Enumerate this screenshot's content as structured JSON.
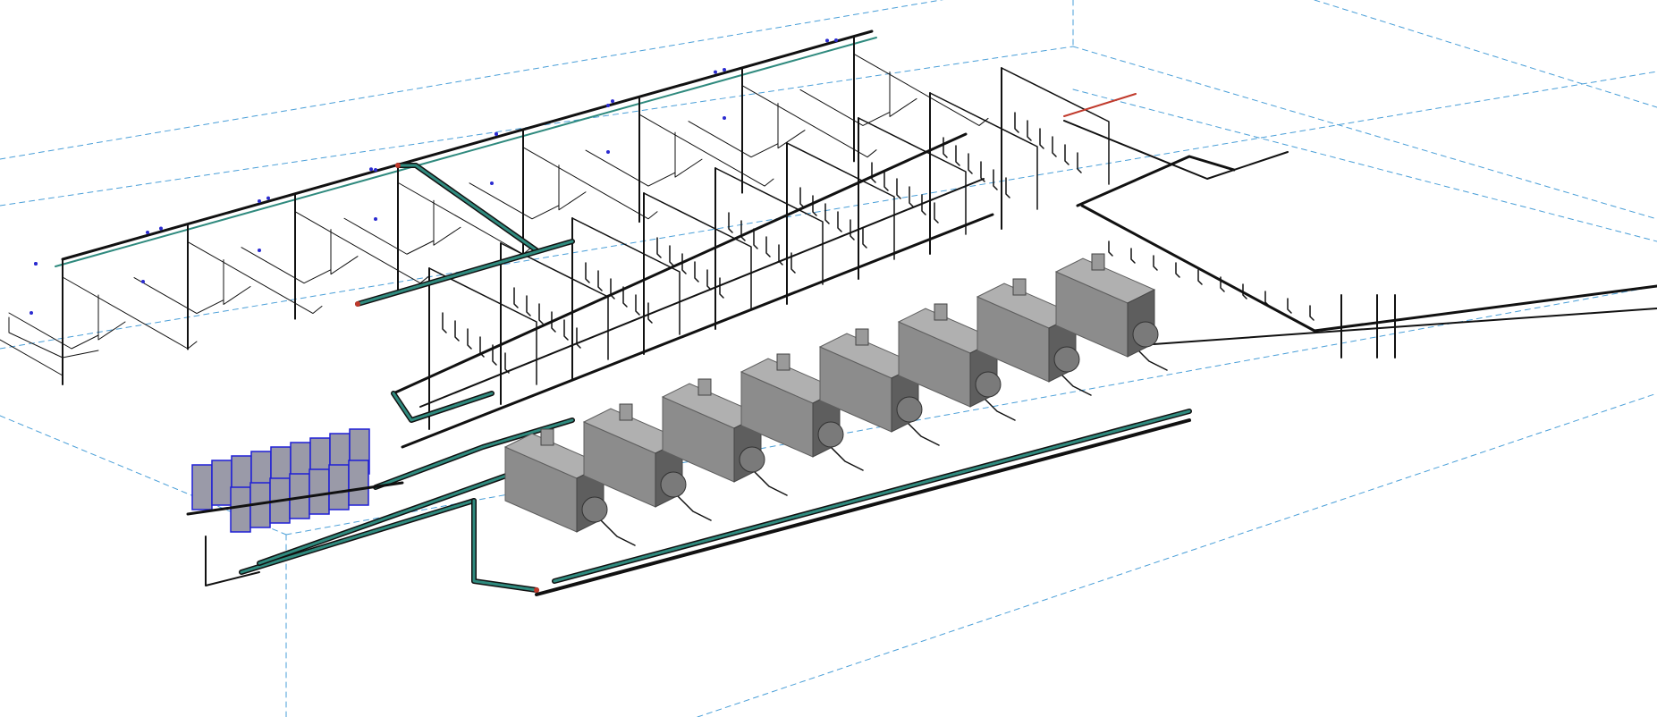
{
  "view": {
    "background": "#ffffff",
    "level_line_color": "#4a9fd8",
    "pipe_color": "#111111",
    "main_header_color": "#2f8a7e",
    "accent_red": "#c0392b",
    "engine_color": "#8c8c8c",
    "engine_dark": "#5e5e5e",
    "panel_fill": "#9a9aa8",
    "panel_edge": "#1f1fd6",
    "fitting_color": "#2b2bd0"
  },
  "equipment": {
    "engine_count": 8,
    "switchboard_front_count": 7,
    "switchboard_back_count": 9
  }
}
